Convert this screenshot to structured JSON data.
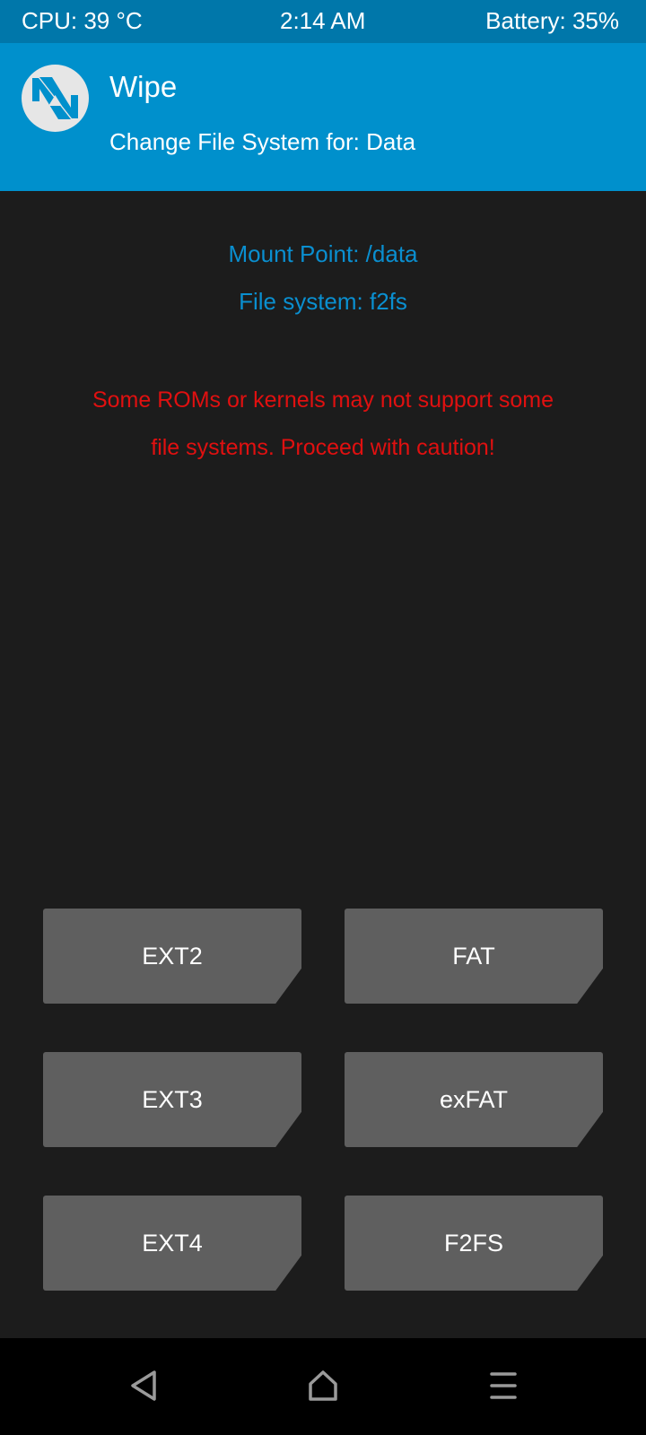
{
  "status_bar": {
    "cpu": "CPU: 39 °C",
    "time": "2:14 AM",
    "battery": "Battery: 35%"
  },
  "header": {
    "title": "Wipe",
    "subtitle": "Change File System for: Data",
    "logo_icon": "twrp-logo-icon"
  },
  "info": {
    "mount_point": "Mount Point: /data",
    "file_system": "File system: f2fs"
  },
  "warning": {
    "line1": "Some ROMs or kernels may not support some",
    "line2": "file systems. Proceed with caution!"
  },
  "buttons": {
    "ext2": "EXT2",
    "fat": "FAT",
    "ext3": "EXT3",
    "exfat": "exFAT",
    "ext4": "EXT4",
    "f2fs": "F2FS"
  },
  "navigation": {
    "back_icon": "back-triangle-icon",
    "home_icon": "home-icon",
    "menu_icon": "menu-icon"
  },
  "colors": {
    "header": "#0090cc",
    "status_bar": "#0077aa",
    "info_text": "#0a8fd0",
    "warning_text": "#e01010",
    "button": "#5f5f5f",
    "background": "#1c1c1c"
  }
}
